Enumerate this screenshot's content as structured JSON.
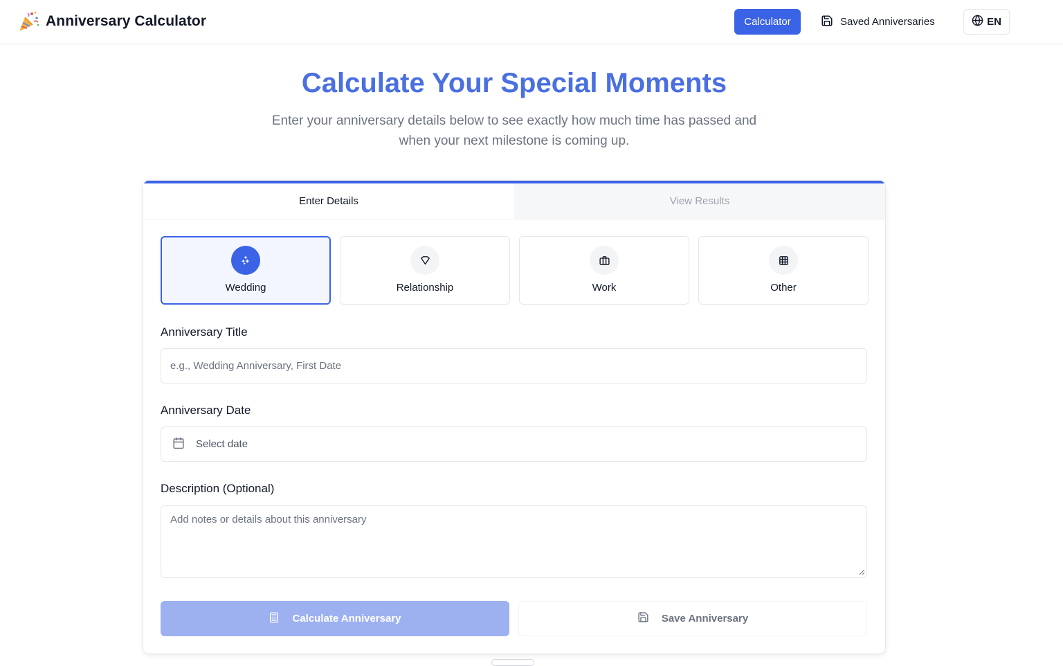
{
  "app": {
    "title": "Anniversary Calculator",
    "logo_icon": "party-popper-icon"
  },
  "nav": {
    "calculator_label": "Calculator",
    "saved_label": "Saved Anniversaries",
    "saved_icon": "floppy-disk-icon",
    "language_label": "EN",
    "language_icon": "globe-icon",
    "active": "Calculator"
  },
  "hero": {
    "title": "Calculate Your Special Moments",
    "subtitle": "Enter your anniversary details below to see exactly how much time has passed and when your next milestone is coming up."
  },
  "tabs": [
    {
      "label": "Enter Details",
      "active": true
    },
    {
      "label": "View Results",
      "active": false
    }
  ],
  "types": [
    {
      "label": "Wedding",
      "icon": "sparkles-icon",
      "selected": true
    },
    {
      "label": "Relationship",
      "icon": "heart-icon",
      "selected": false
    },
    {
      "label": "Work",
      "icon": "briefcase-icon",
      "selected": false
    },
    {
      "label": "Other",
      "icon": "grid-icon",
      "selected": false
    }
  ],
  "form": {
    "title_label": "Anniversary Title",
    "title_value": "",
    "title_placeholder": "e.g., Wedding Anniversary, First Date",
    "date_label": "Anniversary Date",
    "date_placeholder": "Select date",
    "date_icon": "calendar-icon",
    "description_label": "Description (Optional)",
    "description_value": "",
    "description_placeholder": "Add notes or details about this anniversary"
  },
  "actions": {
    "calculate_label": "Calculate Anniversary",
    "calculate_icon": "calculator-icon",
    "save_label": "Save Anniversary",
    "save_icon": "floppy-disk-icon"
  },
  "colors": {
    "primary": "#3b63e6",
    "hero_title": "#4a6fe0",
    "disabled_primary": "#9db1f1"
  }
}
